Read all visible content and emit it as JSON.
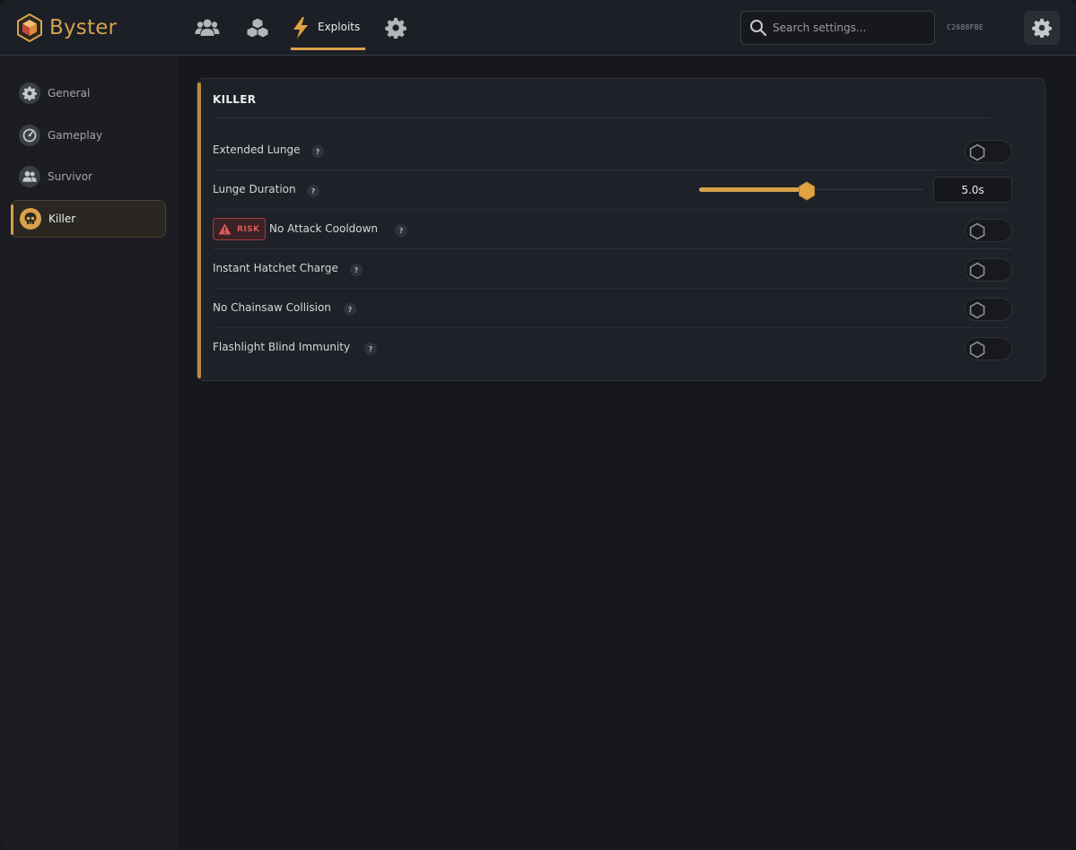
{
  "app": {
    "brand_name": "Byster",
    "accent_color": "#d9a14a",
    "device_id": "C2088FBE"
  },
  "topnav": {
    "items": [
      {
        "name": "users",
        "icon": "users-icon"
      },
      {
        "name": "cubes",
        "icon": "cubes-icon"
      },
      {
        "name": "exploits",
        "icon": "bolt-icon",
        "label": "Exploits",
        "active": true
      },
      {
        "name": "settings",
        "icon": "gear-icon"
      }
    ]
  },
  "search": {
    "placeholder": "Search settings..."
  },
  "sidebar": {
    "items": [
      {
        "label": "General",
        "icon": "gear-icon",
        "active": false
      },
      {
        "label": "Gameplay",
        "icon": "gauge-icon",
        "active": false
      },
      {
        "label": "Survivor",
        "icon": "users-icon",
        "active": false
      },
      {
        "label": "Killer",
        "icon": "skull-icon",
        "active": true
      }
    ]
  },
  "section": {
    "title": "KILLER",
    "rows": [
      {
        "label": "Extended Lunge",
        "type": "toggle",
        "enabled": false
      },
      {
        "label": "Lunge Duration",
        "type": "slider",
        "value_text": "5.0s",
        "slider_fraction": 0.48
      },
      {
        "label": "No Attack Cooldown",
        "type": "toggle",
        "enabled": false,
        "badge": "RISK"
      },
      {
        "label": "Instant Hatchet Charge",
        "type": "toggle",
        "enabled": false
      },
      {
        "label": "No Chainsaw Collision",
        "type": "toggle",
        "enabled": false
      },
      {
        "label": "Flashlight Blind Immunity",
        "type": "toggle",
        "enabled": false
      }
    ],
    "help_glyph": "?"
  }
}
